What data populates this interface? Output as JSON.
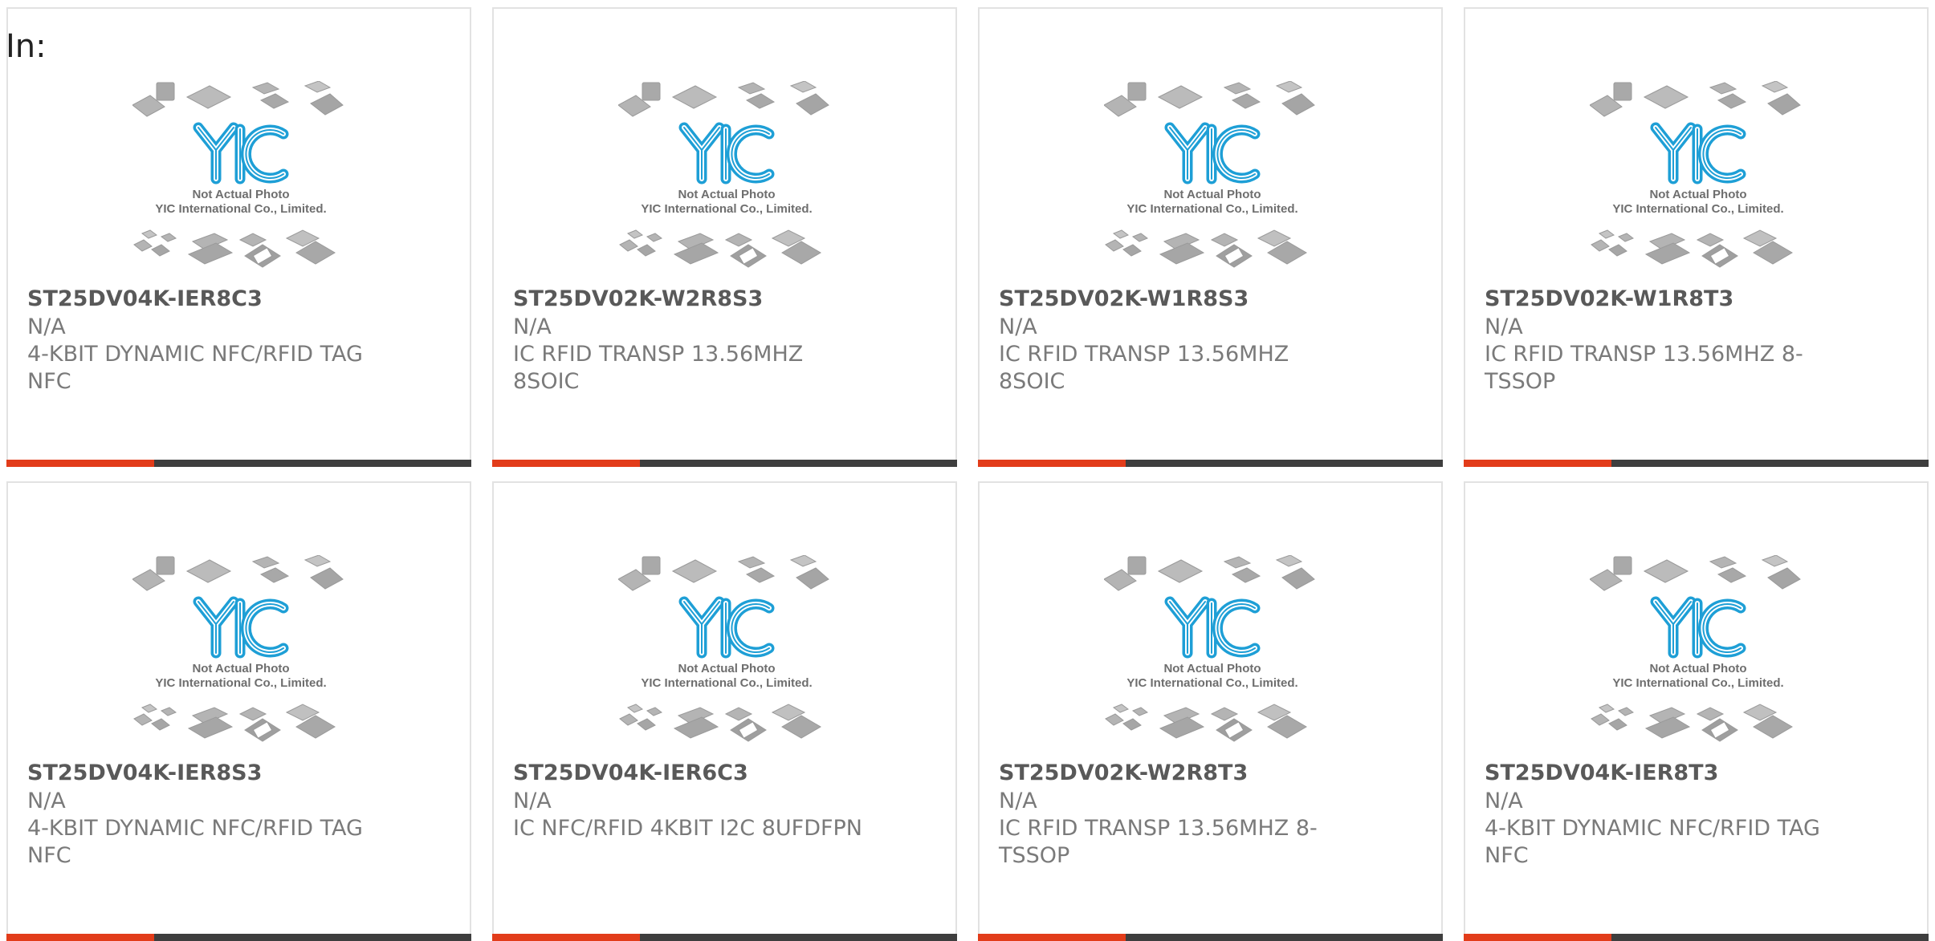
{
  "page": {
    "label": "In:"
  },
  "colors": {
    "accent_bar": "#e23c1a",
    "bar_base": "#3e3e3e",
    "logo_blue": "#1e9fd6",
    "card_border": "#e2e2e2",
    "title_text": "#595959",
    "body_text": "#7a7a7a"
  },
  "placeholder_image": {
    "icon": "chip-packages-placeholder-icon",
    "logo_text": "YIC",
    "caption_line1": "Not Actual Photo",
    "caption_line2": "YIC International Co., Limited."
  },
  "products": [
    {
      "part_number": "ST25DV04K-IER8C3",
      "manufacturer": "N/A",
      "description": "4-KBIT DYNAMIC NFC/RFID TAG NFC"
    },
    {
      "part_number": "ST25DV02K-W2R8S3",
      "manufacturer": "N/A",
      "description": "IC RFID TRANSP 13.56MHZ 8SOIC"
    },
    {
      "part_number": "ST25DV02K-W1R8S3",
      "manufacturer": "N/A",
      "description": "IC RFID TRANSP 13.56MHZ 8SOIC"
    },
    {
      "part_number": "ST25DV02K-W1R8T3",
      "manufacturer": "N/A",
      "description": "IC RFID TRANSP 13.56MHZ 8-TSSOP"
    },
    {
      "part_number": "ST25DV04K-IER8S3",
      "manufacturer": "N/A",
      "description": "4-KBIT DYNAMIC NFC/RFID TAG NFC"
    },
    {
      "part_number": "ST25DV04K-IER6C3",
      "manufacturer": "N/A",
      "description": "IC NFC/RFID 4KBIT I2C 8UFDFPN"
    },
    {
      "part_number": "ST25DV02K-W2R8T3",
      "manufacturer": "N/A",
      "description": "IC RFID TRANSP 13.56MHZ 8-TSSOP"
    },
    {
      "part_number": "ST25DV04K-IER8T3",
      "manufacturer": "N/A",
      "description": "4-KBIT DYNAMIC NFC/RFID TAG NFC"
    }
  ]
}
